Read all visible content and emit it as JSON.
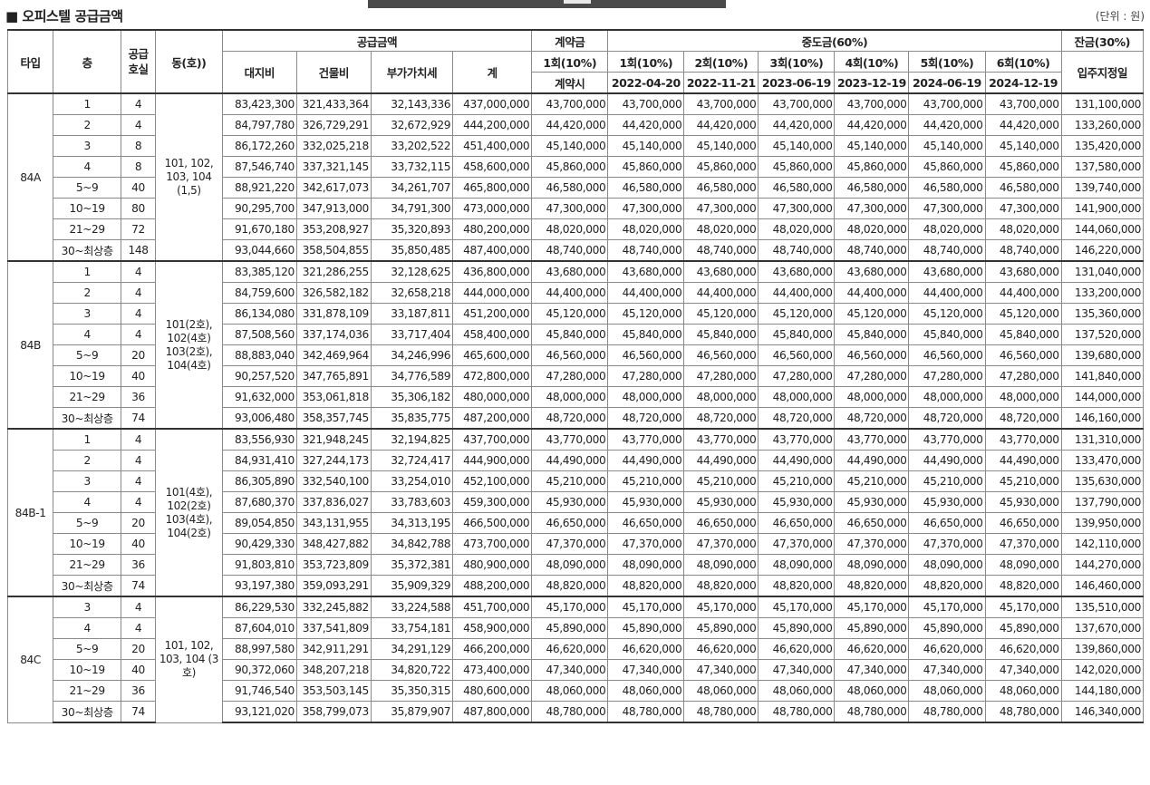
{
  "title": "■ 오피스텔 공급금액",
  "unit_note": "(단위 : 원)",
  "headers": {
    "type": "타입",
    "floor": "층",
    "units": "공급\n호실",
    "dong": "동(호))",
    "supply": "공급금액",
    "land": "대지비",
    "building": "건물비",
    "vat": "부가가치세",
    "total": "계",
    "deposit": "계약금",
    "deposit_pct": "1회(10%)",
    "deposit_when": "계약시",
    "middle": "중도금(60%)",
    "middle_cols": [
      {
        "pct": "1회(10%)",
        "date": "2022-04-20"
      },
      {
        "pct": "2회(10%)",
        "date": "2022-11-21"
      },
      {
        "pct": "3회(10%)",
        "date": "2023-06-19"
      },
      {
        "pct": "4회(10%)",
        "date": "2023-12-19"
      },
      {
        "pct": "5회(10%)",
        "date": "2024-06-19"
      },
      {
        "pct": "6회(10%)",
        "date": "2024-12-19"
      }
    ],
    "balance": "잔금(30%)",
    "balance_when": "입주지정일"
  },
  "groups": [
    {
      "type": "84A",
      "dong": "101, 102, 103, 104 (1,5)",
      "rows": [
        [
          "1",
          "4",
          "83,423,300",
          "321,433,364",
          "32,143,336",
          "437,000,000",
          "43,700,000",
          "43,700,000",
          "131,100,000"
        ],
        [
          "2",
          "4",
          "84,797,780",
          "326,729,291",
          "32,672,929",
          "444,200,000",
          "44,420,000",
          "44,420,000",
          "133,260,000"
        ],
        [
          "3",
          "8",
          "86,172,260",
          "332,025,218",
          "33,202,522",
          "451,400,000",
          "45,140,000",
          "45,140,000",
          "135,420,000"
        ],
        [
          "4",
          "8",
          "87,546,740",
          "337,321,145",
          "33,732,115",
          "458,600,000",
          "45,860,000",
          "45,860,000",
          "137,580,000"
        ],
        [
          "5~9",
          "40",
          "88,921,220",
          "342,617,073",
          "34,261,707",
          "465,800,000",
          "46,580,000",
          "46,580,000",
          "139,740,000"
        ],
        [
          "10~19",
          "80",
          "90,295,700",
          "347,913,000",
          "34,791,300",
          "473,000,000",
          "47,300,000",
          "47,300,000",
          "141,900,000"
        ],
        [
          "21~29",
          "72",
          "91,670,180",
          "353,208,927",
          "35,320,893",
          "480,200,000",
          "48,020,000",
          "48,020,000",
          "144,060,000"
        ],
        [
          "30~최상층",
          "148",
          "93,044,660",
          "358,504,855",
          "35,850,485",
          "487,400,000",
          "48,740,000",
          "48,740,000",
          "146,220,000"
        ]
      ]
    },
    {
      "type": "84B",
      "dong": "101(2호), 102(4호) 103(2호), 104(4호)",
      "rows": [
        [
          "1",
          "4",
          "83,385,120",
          "321,286,255",
          "32,128,625",
          "436,800,000",
          "43,680,000",
          "43,680,000",
          "131,040,000"
        ],
        [
          "2",
          "4",
          "84,759,600",
          "326,582,182",
          "32,658,218",
          "444,000,000",
          "44,400,000",
          "44,400,000",
          "133,200,000"
        ],
        [
          "3",
          "4",
          "86,134,080",
          "331,878,109",
          "33,187,811",
          "451,200,000",
          "45,120,000",
          "45,120,000",
          "135,360,000"
        ],
        [
          "4",
          "4",
          "87,508,560",
          "337,174,036",
          "33,717,404",
          "458,400,000",
          "45,840,000",
          "45,840,000",
          "137,520,000"
        ],
        [
          "5~9",
          "20",
          "88,883,040",
          "342,469,964",
          "34,246,996",
          "465,600,000",
          "46,560,000",
          "46,560,000",
          "139,680,000"
        ],
        [
          "10~19",
          "40",
          "90,257,520",
          "347,765,891",
          "34,776,589",
          "472,800,000",
          "47,280,000",
          "47,280,000",
          "141,840,000"
        ],
        [
          "21~29",
          "36",
          "91,632,000",
          "353,061,818",
          "35,306,182",
          "480,000,000",
          "48,000,000",
          "48,000,000",
          "144,000,000"
        ],
        [
          "30~최상층",
          "74",
          "93,006,480",
          "358,357,745",
          "35,835,775",
          "487,200,000",
          "48,720,000",
          "48,720,000",
          "146,160,000"
        ]
      ]
    },
    {
      "type": "84B-1",
      "dong": "101(4호), 102(2호) 103(4호), 104(2호)",
      "rows": [
        [
          "1",
          "4",
          "83,556,930",
          "321,948,245",
          "32,194,825",
          "437,700,000",
          "43,770,000",
          "43,770,000",
          "131,310,000"
        ],
        [
          "2",
          "4",
          "84,931,410",
          "327,244,173",
          "32,724,417",
          "444,900,000",
          "44,490,000",
          "44,490,000",
          "133,470,000"
        ],
        [
          "3",
          "4",
          "86,305,890",
          "332,540,100",
          "33,254,010",
          "452,100,000",
          "45,210,000",
          "45,210,000",
          "135,630,000"
        ],
        [
          "4",
          "4",
          "87,680,370",
          "337,836,027",
          "33,783,603",
          "459,300,000",
          "45,930,000",
          "45,930,000",
          "137,790,000"
        ],
        [
          "5~9",
          "20",
          "89,054,850",
          "343,131,955",
          "34,313,195",
          "466,500,000",
          "46,650,000",
          "46,650,000",
          "139,950,000"
        ],
        [
          "10~19",
          "40",
          "90,429,330",
          "348,427,882",
          "34,842,788",
          "473,700,000",
          "47,370,000",
          "47,370,000",
          "142,110,000"
        ],
        [
          "21~29",
          "36",
          "91,803,810",
          "353,723,809",
          "35,372,381",
          "480,900,000",
          "48,090,000",
          "48,090,000",
          "144,270,000"
        ],
        [
          "30~최상층",
          "74",
          "93,197,380",
          "359,093,291",
          "35,909,329",
          "488,200,000",
          "48,820,000",
          "48,820,000",
          "146,460,000"
        ]
      ]
    },
    {
      "type": "84C",
      "dong": "101, 102, 103, 104 (3호)",
      "rows": [
        [
          "3",
          "4",
          "86,229,530",
          "332,245,882",
          "33,224,588",
          "451,700,000",
          "45,170,000",
          "45,170,000",
          "135,510,000"
        ],
        [
          "4",
          "4",
          "87,604,010",
          "337,541,809",
          "33,754,181",
          "458,900,000",
          "45,890,000",
          "45,890,000",
          "137,670,000"
        ],
        [
          "5~9",
          "20",
          "88,997,580",
          "342,911,291",
          "34,291,129",
          "466,200,000",
          "46,620,000",
          "46,620,000",
          "139,860,000"
        ],
        [
          "10~19",
          "40",
          "90,372,060",
          "348,207,218",
          "34,820,722",
          "473,400,000",
          "47,340,000",
          "47,340,000",
          "142,020,000"
        ],
        [
          "21~29",
          "36",
          "91,746,540",
          "353,503,145",
          "35,350,315",
          "480,600,000",
          "48,060,000",
          "48,060,000",
          "144,180,000"
        ],
        [
          "30~최상층",
          "74",
          "93,121,020",
          "358,799,073",
          "35,879,907",
          "487,800,000",
          "48,780,000",
          "48,780,000",
          "146,340,000"
        ]
      ]
    }
  ]
}
